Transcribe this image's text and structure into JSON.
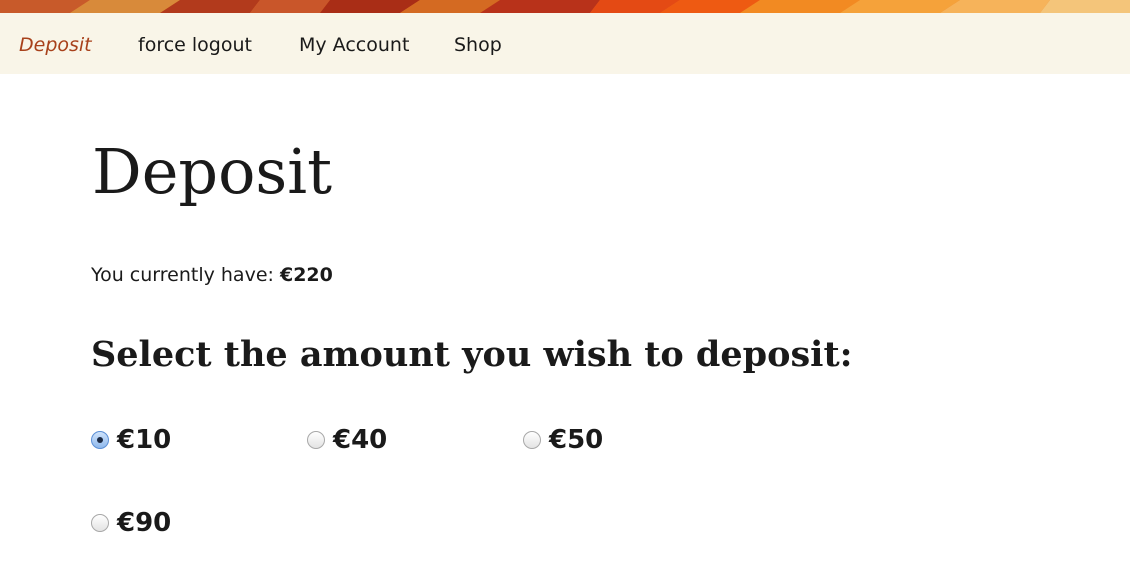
{
  "nav": {
    "items": [
      {
        "label": "Deposit",
        "active": true
      },
      {
        "label": "force logout",
        "active": false
      },
      {
        "label": "My Account",
        "active": false
      },
      {
        "label": "Shop",
        "active": false
      }
    ]
  },
  "page": {
    "title": "Deposit",
    "balance_prefix": "You currently have:",
    "balance_value": "€220",
    "section_title": "Select the amount you wish to deposit:"
  },
  "options": [
    {
      "label": "€10",
      "selected": true
    },
    {
      "label": "€40",
      "selected": false
    },
    {
      "label": "€50",
      "selected": false
    },
    {
      "label": "€90",
      "selected": false
    }
  ],
  "colors": {
    "nav_background": "#f9f5e8",
    "active_nav": "#a8411b",
    "text": "#1a1a1a"
  }
}
